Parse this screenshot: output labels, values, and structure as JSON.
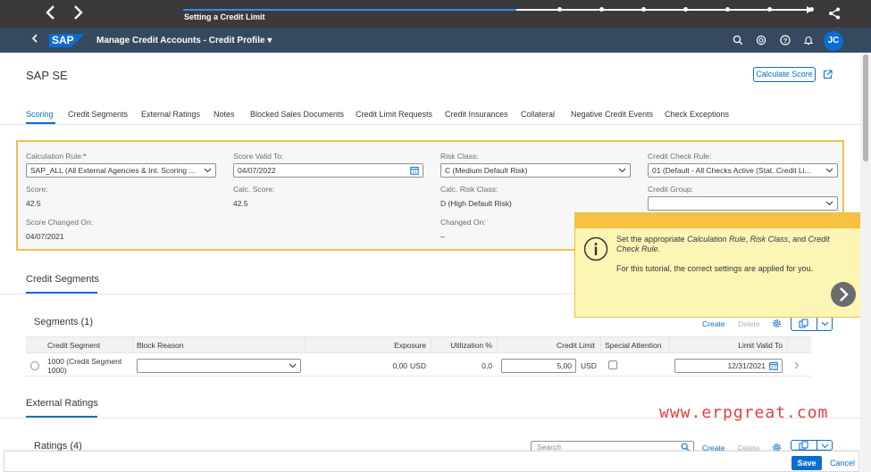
{
  "tutorial": {
    "title": "Setting a Credit Limit",
    "progress_fraction": 0.53,
    "step_dots": 7,
    "popover_text_1_pre": "Set the appropriate ",
    "popover_text_1_em1": "Calculation Rule",
    "popover_text_1_sep1": ", ",
    "popover_text_1_em2": "Risk Class",
    "popover_text_1_sep2": ", and ",
    "popover_text_1_em3": "Credit Check Rule",
    "popover_text_1_end": ".",
    "popover_text_2": "For this tutorial, the correct settings are applied for you."
  },
  "shell": {
    "logo": "SAP",
    "app_title": "Manage Credit Accounts - Credit Profile",
    "avatar": "JC"
  },
  "header": {
    "object_title": "SAP SE",
    "calculate_button": "Calculate Score"
  },
  "tabs": [
    "Scoring",
    "Credit Segments",
    "External Ratings",
    "Notes",
    "Blocked Sales Documents",
    "Credit Limit Requests",
    "Credit Insurances",
    "Collateral",
    "Negative Credit Events",
    "Check Exceptions"
  ],
  "scoring": {
    "calc_rule_label": "Calculation Rule:",
    "calc_rule_required": "*",
    "calc_rule_value": "SAP_ALL (All External Agencies & Int. Scoring ...",
    "score_valid_label": "Score Valid To:",
    "score_valid_value": "04/07/2022",
    "risk_class_label": "Risk Class:",
    "risk_class_value": "C (Medium Default Risk)",
    "check_rule_label": "Credit Check Rule:",
    "check_rule_value": "01 (Default - All Checks Active (Stat. Credit Li...",
    "score_label": "Score:",
    "score_value": "42.5",
    "calc_score_label": "Calc. Score:",
    "calc_score_value": "42.5",
    "calc_risk_label": "Calc. Risk Class:",
    "calc_risk_value": "D (High Default Risk)",
    "credit_group_label": "Credit Group:",
    "credit_group_value": "",
    "score_changed_label": "Score Changed On:",
    "score_changed_value": "04/07/2021",
    "changed_on_label": "Changed On:",
    "changed_on_value": "–"
  },
  "credit_segments": {
    "section_title": "Credit Segments",
    "table_title": "Segments (1)",
    "create": "Create",
    "delete": "Delete",
    "columns": [
      "Credit Segment",
      "Block Reason",
      "Exposure",
      "Utilization %",
      "Credit Limit",
      "Special Attention",
      "Limit Valid To"
    ],
    "row": {
      "segment": "1000 (Credit Segment",
      "segment_line2": "1000)",
      "block_reason": "",
      "exposure": "0,00",
      "exposure_currency": "USD",
      "utilization": "0,0",
      "credit_limit": "5,00",
      "credit_limit_currency": "USD",
      "limit_valid_to": "12/31/2021"
    }
  },
  "external_ratings": {
    "section_title": "External Ratings",
    "table_title": "Ratings (4)",
    "search_placeholder": "Search",
    "create": "Create",
    "delete": "Delete"
  },
  "footer": {
    "save": "Save",
    "cancel": "Cancel"
  },
  "watermark": "www.erpgreat.com",
  "colors": {
    "brand": "#0a6ed1",
    "shell": "#354a5f",
    "highlight": "#f0c14b",
    "popover": "#fdf5b4"
  }
}
